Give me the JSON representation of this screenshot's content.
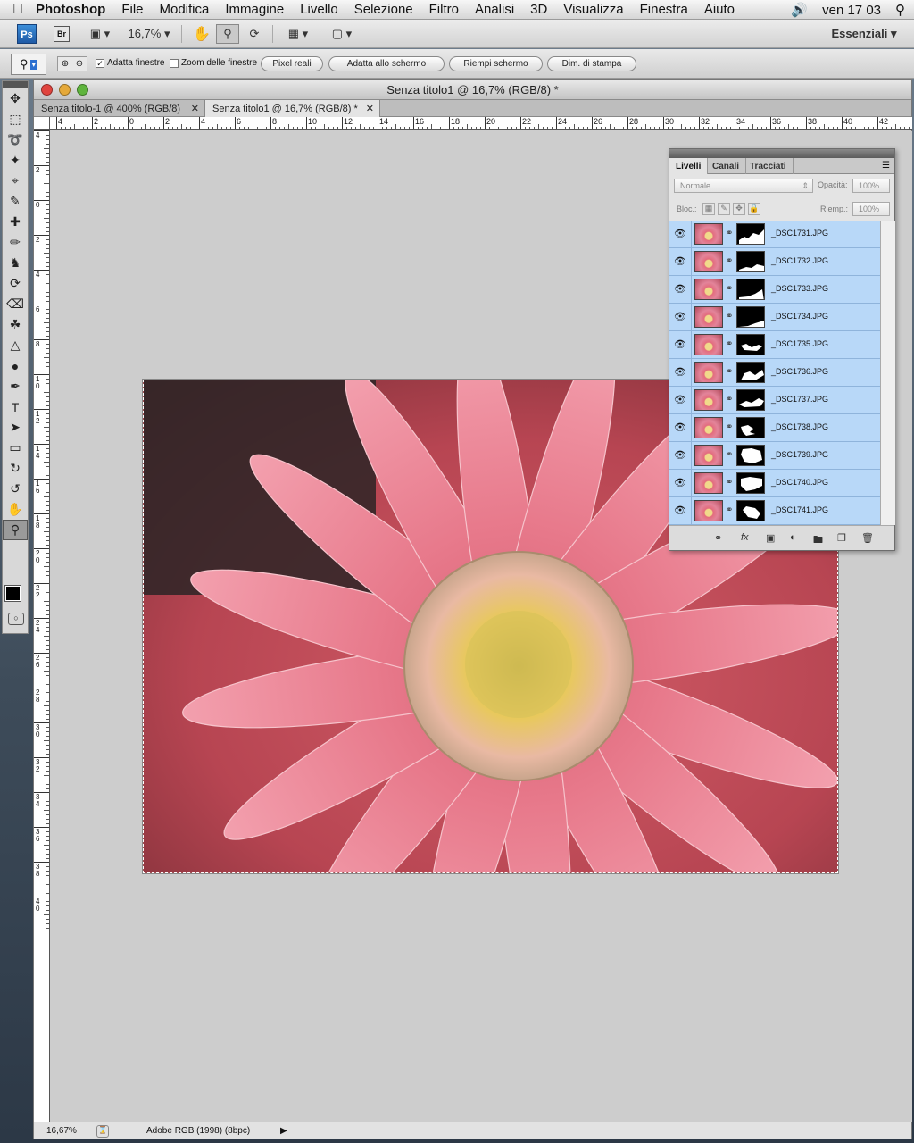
{
  "menubar": {
    "app_name": "Photoshop",
    "items": [
      "File",
      "Modifica",
      "Immagine",
      "Livello",
      "Selezione",
      "Filtro",
      "Analisi",
      "3D",
      "Visualizza",
      "Finestra",
      "Aiuto"
    ],
    "clock": "ven 17 03"
  },
  "appbar": {
    "ps_logo": "Ps",
    "br_logo": "Br",
    "zoom": "16,7%",
    "workspace": "Essenziali"
  },
  "options": {
    "fit_windows_label": "Adatta finestre",
    "fit_windows_checked": true,
    "zoom_all_label": "Zoom delle finestre",
    "zoom_all_checked": false,
    "actual_pixels": "Pixel reali",
    "fit_screen": "Adatta allo schermo",
    "fill_screen": "Riempi schermo",
    "print_size": "Dim. di stampa"
  },
  "document": {
    "title": "Senza titolo1 @ 16,7% (RGB/8) *",
    "tabs": [
      {
        "label": "Senza titolo-1 @ 400% (RGB/8)",
        "active": false
      },
      {
        "label": "Senza titolo1 @ 16,7% (RGB/8) *",
        "active": true
      }
    ]
  },
  "ruler": {
    "h_ticks": [
      "4",
      "2",
      "0",
      "2",
      "4",
      "6",
      "8",
      "10",
      "12",
      "14",
      "16",
      "18",
      "20",
      "22",
      "24",
      "26",
      "28",
      "30",
      "32",
      "34",
      "36",
      "38",
      "40",
      "42"
    ],
    "v_ticks": [
      "4",
      "2",
      "0",
      "2",
      "4",
      "6",
      "8",
      "10",
      "12",
      "14",
      "16",
      "18",
      "20",
      "22",
      "24",
      "26",
      "28",
      "30",
      "32",
      "34",
      "36",
      "38",
      "40"
    ]
  },
  "statusbar": {
    "zoom": "16,67%",
    "profile": "Adobe RGB (1998) (8bpc)"
  },
  "layers_panel": {
    "tabs": [
      "Livelli",
      "Canali",
      "Tracciati"
    ],
    "blend_mode": "Normale",
    "opacity_label": "Opacità:",
    "opacity_value": "100%",
    "lock_label": "Bloc.:",
    "fill_label": "Riemp.:",
    "fill_value": "100%",
    "layers": [
      {
        "name": "_DSC1731.JPG"
      },
      {
        "name": "_DSC1732.JPG"
      },
      {
        "name": "_DSC1733.JPG"
      },
      {
        "name": "_DSC1734.JPG"
      },
      {
        "name": "_DSC1735.JPG"
      },
      {
        "name": "_DSC1736.JPG"
      },
      {
        "name": "_DSC1737.JPG"
      },
      {
        "name": "_DSC1738.JPG"
      },
      {
        "name": "_DSC1739.JPG"
      },
      {
        "name": "_DSC1740.JPG"
      },
      {
        "name": "_DSC1741.JPG"
      }
    ]
  },
  "colors": {
    "layer_selected": "#b8d8f8",
    "canvas_bg": "#cdcdcd",
    "petal": "#e57a86",
    "center": "#e8c95a"
  }
}
